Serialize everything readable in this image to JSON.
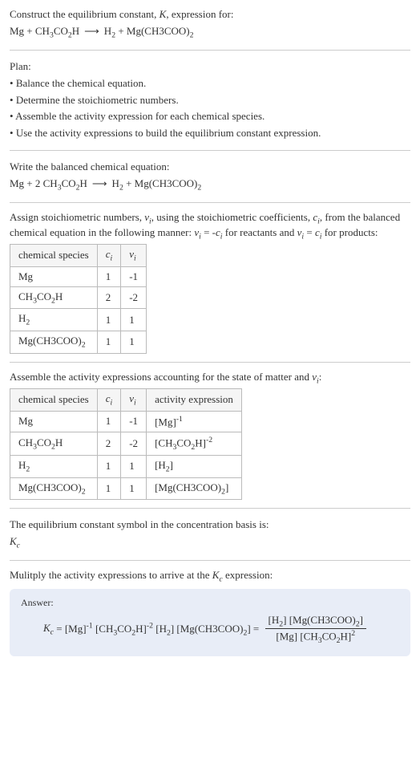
{
  "intro": {
    "line1": "Construct the equilibrium constant, K, expression for:",
    "eq": "Mg + CH₃CO₂H ⟶ H₂ + Mg(CH3COO)₂"
  },
  "plan": {
    "heading": "Plan:",
    "items": [
      "Balance the chemical equation.",
      "Determine the stoichiometric numbers.",
      "Assemble the activity expression for each chemical species.",
      "Use the activity expressions to build the equilibrium constant expression."
    ]
  },
  "balanced": {
    "heading": "Write the balanced chemical equation:",
    "eq": "Mg + 2 CH₃CO₂H ⟶ H₂ + Mg(CH3COO)₂"
  },
  "stoich": {
    "intro_a": "Assign stoichiometric numbers, νᵢ, using the stoichiometric coefficients, cᵢ, from the balanced chemical equation in the following manner: νᵢ = -cᵢ for reactants and νᵢ = cᵢ for products:",
    "headers": [
      "chemical species",
      "cᵢ",
      "νᵢ"
    ],
    "rows": [
      {
        "sp": "Mg",
        "c": "1",
        "v": "-1"
      },
      {
        "sp": "CH₃CO₂H",
        "c": "2",
        "v": "-2"
      },
      {
        "sp": "H₂",
        "c": "1",
        "v": "1"
      },
      {
        "sp": "Mg(CH3COO)₂",
        "c": "1",
        "v": "1"
      }
    ]
  },
  "activity": {
    "intro": "Assemble the activity expressions accounting for the state of matter and νᵢ:",
    "headers": [
      "chemical species",
      "cᵢ",
      "νᵢ",
      "activity expression"
    ],
    "rows": [
      {
        "sp": "Mg",
        "c": "1",
        "v": "-1",
        "ae": "[Mg]⁻¹"
      },
      {
        "sp": "CH₃CO₂H",
        "c": "2",
        "v": "-2",
        "ae": "[CH₃CO₂H]⁻²"
      },
      {
        "sp": "H₂",
        "c": "1",
        "v": "1",
        "ae": "[H₂]"
      },
      {
        "sp": "Mg(CH3COO)₂",
        "c": "1",
        "v": "1",
        "ae": "[Mg(CH3COO)₂]"
      }
    ]
  },
  "symbol": {
    "line": "The equilibrium constant symbol in the concentration basis is:",
    "val": "K_c"
  },
  "multiply": "Mulitply the activity expressions to arrive at the K_c expression:",
  "answer": {
    "label": "Answer:",
    "lhs": "K_c = [Mg]⁻¹ [CH₃CO₂H]⁻² [H₂] [Mg(CH3COO)₂] =",
    "num": "[H₂] [Mg(CH3COO)₂]",
    "den": "[Mg] [CH₃CO₂H]²"
  }
}
